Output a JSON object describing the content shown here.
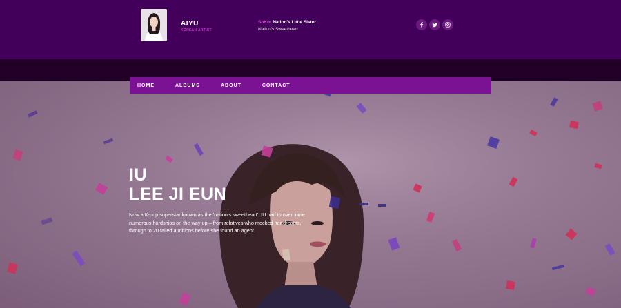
{
  "header": {
    "brand_name": "AIYU",
    "brand_subtitle": "KOREAN ARTIST",
    "tagline_accent": "SoKor",
    "tagline_main": "Nation's Little Sister",
    "tagline_line2": "Nation's Sweetheart",
    "social_icons": [
      "facebook-icon",
      "twitter-icon",
      "instagram-icon"
    ]
  },
  "nav": {
    "items": [
      "HOME",
      "ALBUMS",
      "ABOUT",
      "CONTACT"
    ]
  },
  "hero": {
    "title_line1": "IU",
    "title_line2": "LEE JI EUN",
    "description": "Now a K-pop superstar known as the 'nation's sweetheart', IU had to overcome numerous hardships on the way up – from relatives who mocked her dreams, through to 20 failed auditions before she found an agent."
  },
  "colors": {
    "header_bg": "#42005a",
    "band_bg": "#200025",
    "nav_bg": "#7b1294",
    "accent": "#cc33cc"
  }
}
